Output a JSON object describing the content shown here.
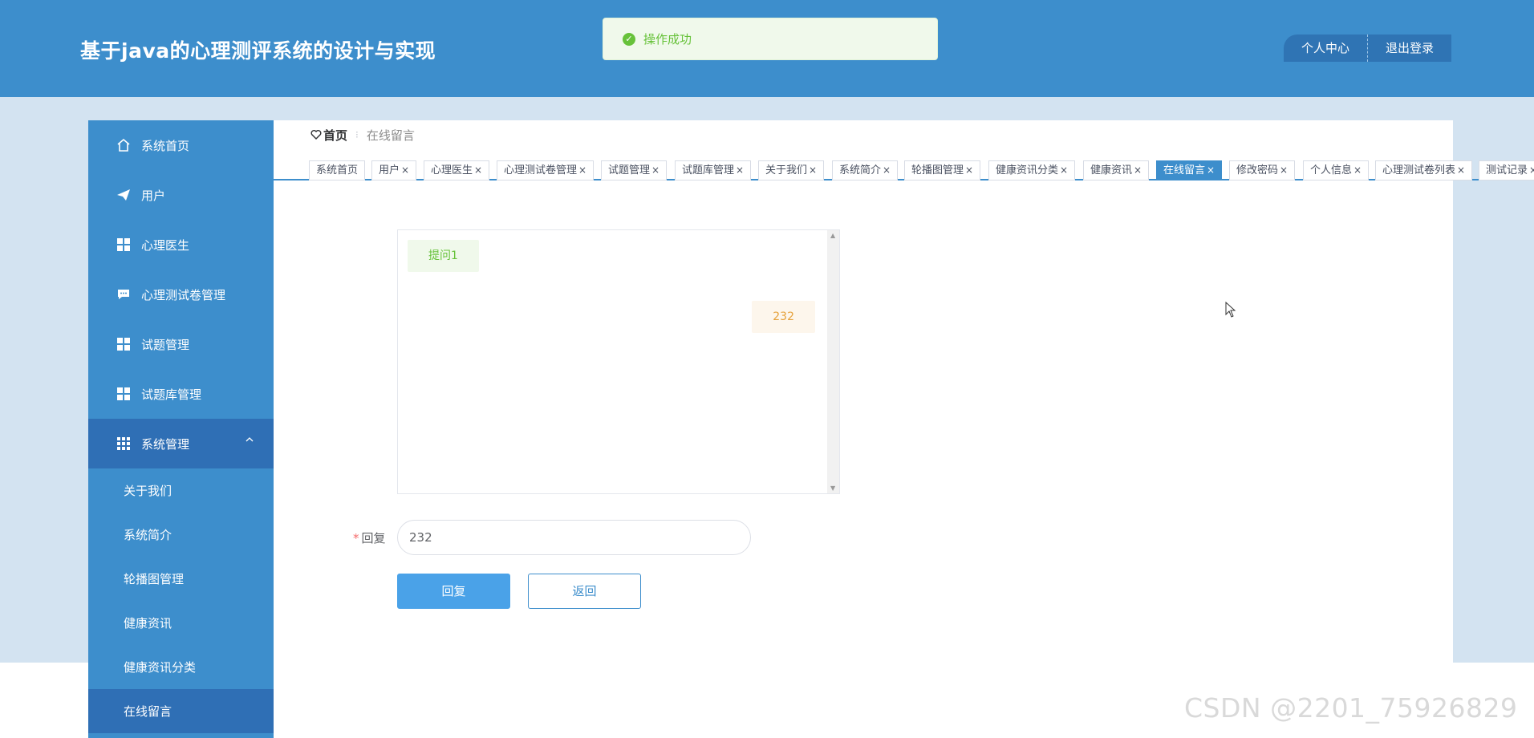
{
  "header": {
    "title": "基于java的心理测评系统的设计与实现",
    "profile_label": "个人中心",
    "logout_label": "退出登录"
  },
  "toast": {
    "message": "操作成功",
    "icon": "check-circle-icon",
    "color": "#67c23a"
  },
  "sidebar": {
    "items": [
      {
        "label": "系统首页",
        "icon": "home-icon"
      },
      {
        "label": "用户",
        "icon": "paper-plane-icon"
      },
      {
        "label": "心理医生",
        "icon": "grid-icon"
      },
      {
        "label": "心理测试卷管理",
        "icon": "chat-icon"
      },
      {
        "label": "试题管理",
        "icon": "grid-icon"
      },
      {
        "label": "试题库管理",
        "icon": "grid-icon"
      },
      {
        "label": "系统管理",
        "icon": "grid9-icon",
        "expanded": true
      }
    ],
    "sub_items": [
      {
        "label": "关于我们"
      },
      {
        "label": "系统简介"
      },
      {
        "label": "轮播图管理"
      },
      {
        "label": "健康资讯"
      },
      {
        "label": "健康资讯分类"
      },
      {
        "label": "在线留言",
        "active": true
      }
    ]
  },
  "breadcrumb": {
    "home": "首页",
    "current": "在线留言"
  },
  "tabs": [
    {
      "label": "系统首页",
      "closable": false
    },
    {
      "label": "用户",
      "closable": true
    },
    {
      "label": "心理医生",
      "closable": true
    },
    {
      "label": "心理测试卷管理",
      "closable": true
    },
    {
      "label": "试题管理",
      "closable": true
    },
    {
      "label": "试题库管理",
      "closable": true
    },
    {
      "label": "关于我们",
      "closable": true
    },
    {
      "label": "系统简介",
      "closable": true
    },
    {
      "label": "轮播图管理",
      "closable": true
    },
    {
      "label": "健康资讯分类",
      "closable": true
    },
    {
      "label": "健康资讯",
      "closable": true
    },
    {
      "label": "在线留言",
      "closable": true,
      "active": true
    },
    {
      "label": "修改密码",
      "closable": true
    },
    {
      "label": "个人信息",
      "closable": true
    },
    {
      "label": "心理测试卷列表",
      "closable": true
    },
    {
      "label": "测试记录",
      "closable": true
    }
  ],
  "tab_close_glyph": "×",
  "chat": {
    "question": "提问1",
    "answer": "232"
  },
  "form": {
    "reply_label": "回复",
    "required_mark": "*",
    "reply_value": "232",
    "submit_label": "回复",
    "back_label": "返回"
  },
  "watermark": "CSDN @2201_75926829",
  "colors": {
    "primary": "#3d8ecc",
    "primary_dark": "#2f6fb5",
    "success": "#67c23a",
    "warning": "#e6a23c"
  }
}
